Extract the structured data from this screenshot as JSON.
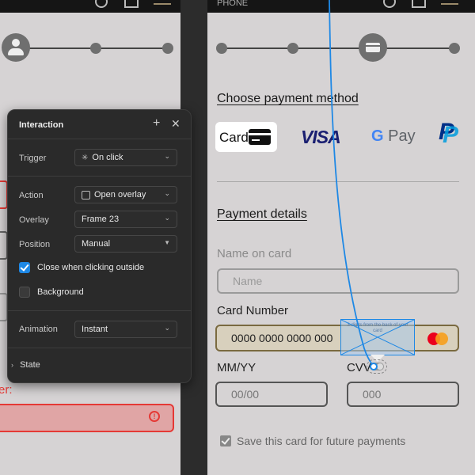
{
  "colors": {
    "canvas": "#2c2c2c",
    "frame": "#d6d3d4",
    "panel": "#2a2a2a",
    "accent": "#1e88e5",
    "error": "#e53935"
  },
  "left_frame": {
    "error_label": "er:",
    "error_icon": "alert-circle-icon"
  },
  "right_frame": {
    "label": "PHONE",
    "choose_payment_title": "Choose payment method",
    "payment_methods": {
      "card": "Card",
      "visa": "VISA",
      "gpay_g": "G",
      "gpay": "Pay"
    },
    "payment_details_title": "Payment details",
    "name_on_card": {
      "label": "Name on card",
      "placeholder": "Name"
    },
    "card_number": {
      "label": "Card Number",
      "value": "0000 0000 0000 000"
    },
    "expiry": {
      "label": "MM/YY",
      "placeholder": "00/00"
    },
    "cvv": {
      "label": "CVV",
      "placeholder": "000"
    },
    "tooltip_text": "3 digits from the back of your card",
    "save_card": "Save this card for future payments"
  },
  "panel": {
    "title": "Interaction",
    "trigger_label": "Trigger",
    "trigger_value": "On click",
    "action_label": "Action",
    "action_value": "Open overlay",
    "overlay_label": "Overlay",
    "overlay_value": "Frame 23",
    "position_label": "Position",
    "position_value": "Manual",
    "close_outside": "Close when clicking outside",
    "background": "Background",
    "animation_label": "Animation",
    "animation_value": "Instant",
    "state": "State"
  }
}
